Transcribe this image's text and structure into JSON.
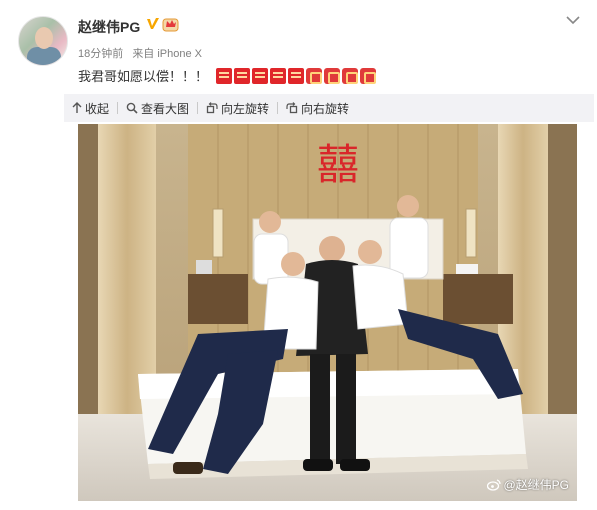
{
  "post": {
    "username": "赵继伟PG",
    "time": "18分钟前",
    "source": "来自 iPhone X",
    "text": "我君哥如愿以偿！！！",
    "emojis": [
      "xi",
      "xi",
      "xi",
      "xi",
      "xi",
      "fu",
      "fu",
      "fu",
      "fu"
    ]
  },
  "toolbar": {
    "collapse_label": "收起",
    "view_large_label": "查看大图",
    "rotate_left_label": "向左旋转",
    "rotate_right_label": "向右旋转"
  },
  "photo": {
    "wall_character": "囍",
    "watermark": "@赵继伟PG"
  },
  "icons": {
    "verified": "verified-v-icon",
    "member": "member-crown-icon",
    "expand": "chevron-down-icon"
  },
  "colors": {
    "verified": "#f7a600",
    "xi_red": "#d9262a",
    "toolbar_bg": "#f2f2f5"
  }
}
